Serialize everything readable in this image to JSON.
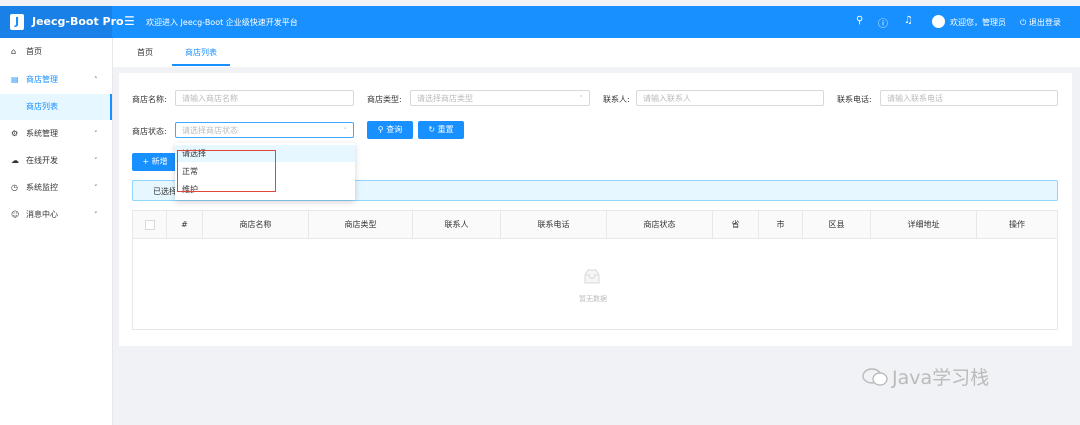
{
  "header": {
    "logo_letter": "J",
    "app_name": "Jeecg-Boot Pro",
    "welcome": "欢迎进入 Jeecg-Boot 企业级快速开发平台",
    "user_greeting": "欢迎您，管理员",
    "logout": "退出登录"
  },
  "sidebar": {
    "items": [
      {
        "label": "首页"
      },
      {
        "label": "商店管理"
      },
      {
        "label": "商店列表"
      },
      {
        "label": "系统管理"
      },
      {
        "label": "在线开发"
      },
      {
        "label": "系统监控"
      },
      {
        "label": "消息中心"
      }
    ]
  },
  "tabs": [
    {
      "label": "首页"
    },
    {
      "label": "商店列表"
    }
  ],
  "filters": {
    "name_label": "商店名称:",
    "name_placeholder": "请输入商店名称",
    "type_label": "商店类型:",
    "type_placeholder": "请选择商店类型",
    "contact_label": "联系人:",
    "contact_placeholder": "请输入联系人",
    "phone_label": "联系电话:",
    "phone_placeholder": "请输入联系电话",
    "status_label": "商店状态:",
    "status_placeholder": "请选择商店状态",
    "query_button": "查询",
    "reset_button": "重置"
  },
  "add_button": "新增",
  "status_dropdown": {
    "options": [
      "请选择",
      "正常",
      "维护"
    ]
  },
  "alert_text": "已选择",
  "table": {
    "columns": [
      "#",
      "商店名称",
      "商店类型",
      "联系人",
      "联系电话",
      "商店状态",
      "省",
      "市",
      "区县",
      "详细地址",
      "操作"
    ],
    "empty_text": "暂无数据"
  },
  "watermark": "Java学习栈",
  "colors": {
    "primary": "#1890ff",
    "highlight_box": "#e0463c"
  }
}
